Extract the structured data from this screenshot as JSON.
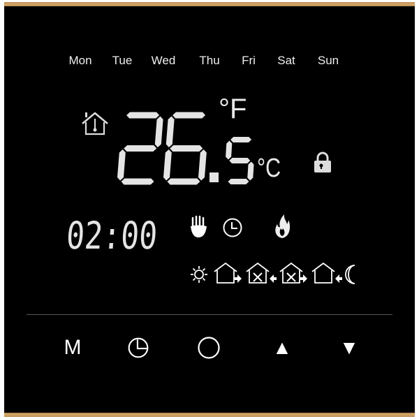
{
  "days": [
    "Mon",
    "Tue",
    "Wed",
    "Thu",
    "Fri",
    "Sat",
    "Sun"
  ],
  "temperature": {
    "integer": "26",
    "decimal": "5",
    "unit_f": "°F",
    "unit_c": "°C"
  },
  "time": "02:00",
  "status_icons": [
    "home-thermometer-icon",
    "lock-icon",
    "manual-hand-icon",
    "clock-icon",
    "flame-icon"
  ],
  "program_icons": [
    "sun-icon",
    "leave-home-icon",
    "return-home-icon",
    "leave-home-2-icon",
    "return-home-2-icon",
    "moon-icon"
  ],
  "buttons": {
    "mode": "M",
    "clock": "clock-icon",
    "power": "power-circle-icon",
    "up": "▲",
    "down": "▼"
  },
  "colors": {
    "frame": "#c89a5e",
    "segment": "#e4e4e4",
    "background": "#000000"
  }
}
